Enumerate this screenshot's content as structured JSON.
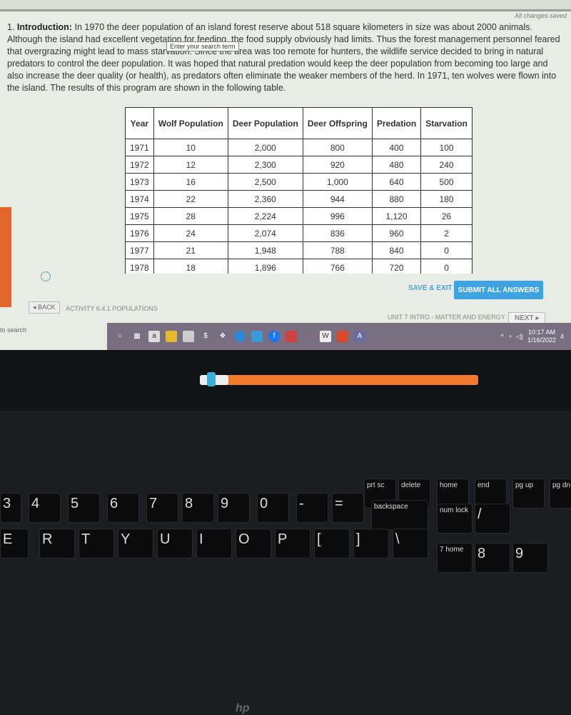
{
  "status": "All changes saved",
  "intro": {
    "number": "1.",
    "heading": "Introduction:",
    "text": " In 1970 the deer population of an island forest reserve about 518 square kilometers in size was about 2000 animals. Although the island had excellent vegetation for feeding, the food supply obviously had limits. Thus the forest management personnel feared that overgrazing might lead to mass starvation. Since the area was too remote for hunters, the wildlife service decided to bring in natural predators to control the deer population. It was hoped that natural predation would keep the deer population from becoming too large and also increase the deer quality (or health), as predators often eliminate the weaker members of the herd. In 1971, ten wolves were flown into the island.  The results of this program are shown in the following table."
  },
  "tooltip": "Enter your search term",
  "table": {
    "headers": [
      "Year",
      "Wolf Population",
      "Deer Population",
      "Deer Offspring",
      "Predation",
      "Starvation"
    ],
    "rows": [
      [
        "1971",
        "10",
        "2,000",
        "800",
        "400",
        "100"
      ],
      [
        "1972",
        "12",
        "2,300",
        "920",
        "480",
        "240"
      ],
      [
        "1973",
        "16",
        "2,500",
        "1,000",
        "640",
        "500"
      ],
      [
        "1974",
        "22",
        "2,360",
        "944",
        "880",
        "180"
      ],
      [
        "1975",
        "28",
        "2,224",
        "996",
        "1,120",
        "26"
      ],
      [
        "1976",
        "24",
        "2,074",
        "836",
        "960",
        "2"
      ],
      [
        "1977",
        "21",
        "1,948",
        "788",
        "840",
        "0"
      ],
      [
        "1978",
        "18",
        "1,896",
        "766",
        "720",
        "0"
      ]
    ]
  },
  "actions": {
    "save_exit": "SAVE & EXIT",
    "submit": "SUBMIT ALL ANSWERS"
  },
  "nav": {
    "back": "◂ BACK",
    "activity": "ACTIVITY 6.4.1 POPULATIONS",
    "unit": "UNIT 7 INTRO - MATTER AND ENERGY",
    "next": "NEXT ▸"
  },
  "taskbar": {
    "search": "to search",
    "time": "10:17 AM",
    "date": "1/16/2022",
    "notifications": "4"
  },
  "logo": "hp",
  "keyboard": {
    "keys": [
      "prt sc",
      "delete",
      "home",
      "end",
      "pg up",
      "pg dn",
      "3",
      "4",
      "5",
      "6",
      "7",
      "8",
      "9",
      "0",
      "-",
      "=",
      "backspace",
      "num lock",
      "/",
      "E",
      "R",
      "T",
      "Y",
      "U",
      "I",
      "O",
      "P",
      "[",
      "]",
      "\\",
      "7 home",
      "8",
      "9"
    ]
  }
}
